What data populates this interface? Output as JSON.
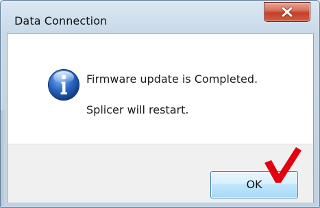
{
  "window": {
    "title": "Data Connection"
  },
  "titlebar": {
    "close_icon": "close-x-icon"
  },
  "message": {
    "icon": "information-icon",
    "line1": "Firmware update is Completed.",
    "line2": "Splicer will restart."
  },
  "buttons": {
    "ok_label": "OK"
  },
  "annotation": {
    "icon": "red-checkmark-icon",
    "color": "#e3000f"
  },
  "colors": {
    "close_button": "#c4412a",
    "ok_button_border": "#3c7fb1",
    "info_icon_blue": "#1e5bb8"
  }
}
